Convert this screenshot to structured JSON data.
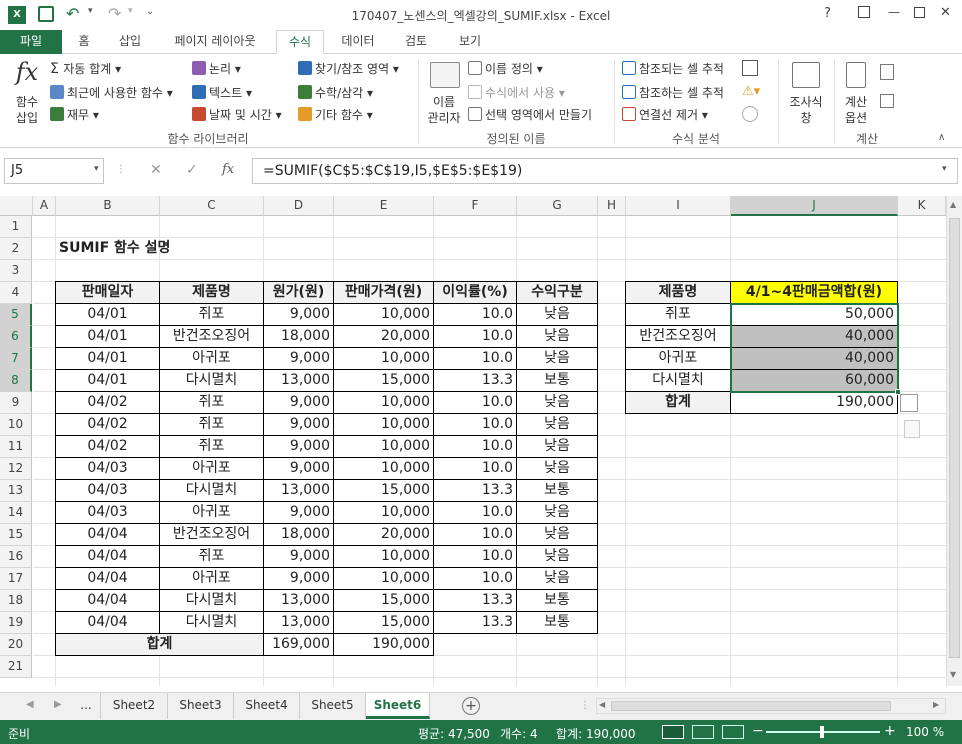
{
  "window": {
    "title": "170407_노센스의_엑셀강의_SUMIF.xlsx - Excel",
    "help": "?",
    "min": "—",
    "close": "✕"
  },
  "tabs": [
    "파일",
    "홈",
    "삽입",
    "페이지 레이아웃",
    "수식",
    "데이터",
    "검토",
    "보기"
  ],
  "ribbon": {
    "insert_fn": "함수\n삽입",
    "autosum": "자동 합계",
    "recent": "최근에 사용한 함수",
    "finance": "재무",
    "logic": "논리",
    "text": "텍스트",
    "datetime": "날짜 및 시간",
    "lookup": "찾기/참조 영역",
    "math": "수학/삼각",
    "more": "기타 함수",
    "group_fnlib": "함수 라이브러리",
    "name_mgr": "이름\n관리자",
    "define_name": "이름 정의",
    "use_in_formula": "수식에서 사용",
    "create_sel": "선택 영역에서 만들기",
    "group_names": "정의된 이름",
    "trace_prec": "참조되는 셀 추적",
    "trace_dep": "참조하는 셀 추적",
    "remove_arrows": "연결선 제거",
    "group_audit": "수식 분석",
    "watch": "조사식\n창",
    "calc_opts": "계산\n옵션",
    "group_calc": "계산"
  },
  "formula_bar": {
    "name_box": "J5",
    "fx": "fx",
    "formula": "=SUMIF($C$5:$C$19,I5,$E$5:$E$19)"
  },
  "columns": [
    "A",
    "B",
    "C",
    "D",
    "E",
    "F",
    "G",
    "H",
    "I",
    "J",
    "K"
  ],
  "rows": [
    "1",
    "2",
    "3",
    "4",
    "5",
    "6",
    "7",
    "8",
    "9",
    "10",
    "11",
    "12",
    "13",
    "14",
    "15",
    "16",
    "17",
    "18",
    "19",
    "20",
    "21"
  ],
  "sheet": {
    "title": "SUMIF 함수 설명",
    "headers": [
      "판매일자",
      "제품명",
      "원가(원)",
      "판매가격(원)",
      "이익률(%)",
      "수익구분"
    ],
    "data": [
      [
        "04/01",
        "쥐포",
        "9,000",
        "10,000",
        "10.0",
        "낮음"
      ],
      [
        "04/01",
        "반건조오징어",
        "18,000",
        "20,000",
        "10.0",
        "낮음"
      ],
      [
        "04/01",
        "아귀포",
        "9,000",
        "10,000",
        "10.0",
        "낮음"
      ],
      [
        "04/01",
        "다시멸치",
        "13,000",
        "15,000",
        "13.3",
        "보통"
      ],
      [
        "04/02",
        "쥐포",
        "9,000",
        "10,000",
        "10.0",
        "낮음"
      ],
      [
        "04/02",
        "쥐포",
        "9,000",
        "10,000",
        "10.0",
        "낮음"
      ],
      [
        "04/02",
        "쥐포",
        "9,000",
        "10,000",
        "10.0",
        "낮음"
      ],
      [
        "04/03",
        "아귀포",
        "9,000",
        "10,000",
        "10.0",
        "낮음"
      ],
      [
        "04/03",
        "다시멸치",
        "13,000",
        "15,000",
        "13.3",
        "보통"
      ],
      [
        "04/03",
        "아귀포",
        "9,000",
        "10,000",
        "10.0",
        "낮음"
      ],
      [
        "04/04",
        "반건조오징어",
        "18,000",
        "20,000",
        "10.0",
        "낮음"
      ],
      [
        "04/04",
        "쥐포",
        "9,000",
        "10,000",
        "10.0",
        "낮음"
      ],
      [
        "04/04",
        "아귀포",
        "9,000",
        "10,000",
        "10.0",
        "낮음"
      ],
      [
        "04/04",
        "다시멸치",
        "13,000",
        "15,000",
        "13.3",
        "보통"
      ],
      [
        "04/04",
        "다시멸치",
        "13,000",
        "15,000",
        "13.3",
        "보통"
      ]
    ],
    "total_label": "합계",
    "total_cost": "169,000",
    "total_price": "190,000",
    "summary_headers": [
      "제품명",
      "4/1~4판매금액합(원)"
    ],
    "summary": [
      [
        "쥐포",
        "50,000"
      ],
      [
        "반건조오징어",
        "40,000"
      ],
      [
        "아귀포",
        "40,000"
      ],
      [
        "다시멸치",
        "60,000"
      ]
    ],
    "summary_total_label": "합계",
    "summary_total": "190,000"
  },
  "sheet_tabs": [
    "...",
    "Sheet2",
    "Sheet3",
    "Sheet4",
    "Sheet5",
    "Sheet6"
  ],
  "status": {
    "ready": "준비",
    "avg": "평균: 47,500",
    "count": "개수: 4",
    "sum": "합계: 190,000",
    "zoom": "100 %"
  },
  "colors": {
    "excel_green": "#217346",
    "summary_header": "#ffff00",
    "selected": "#c0c0c0"
  }
}
